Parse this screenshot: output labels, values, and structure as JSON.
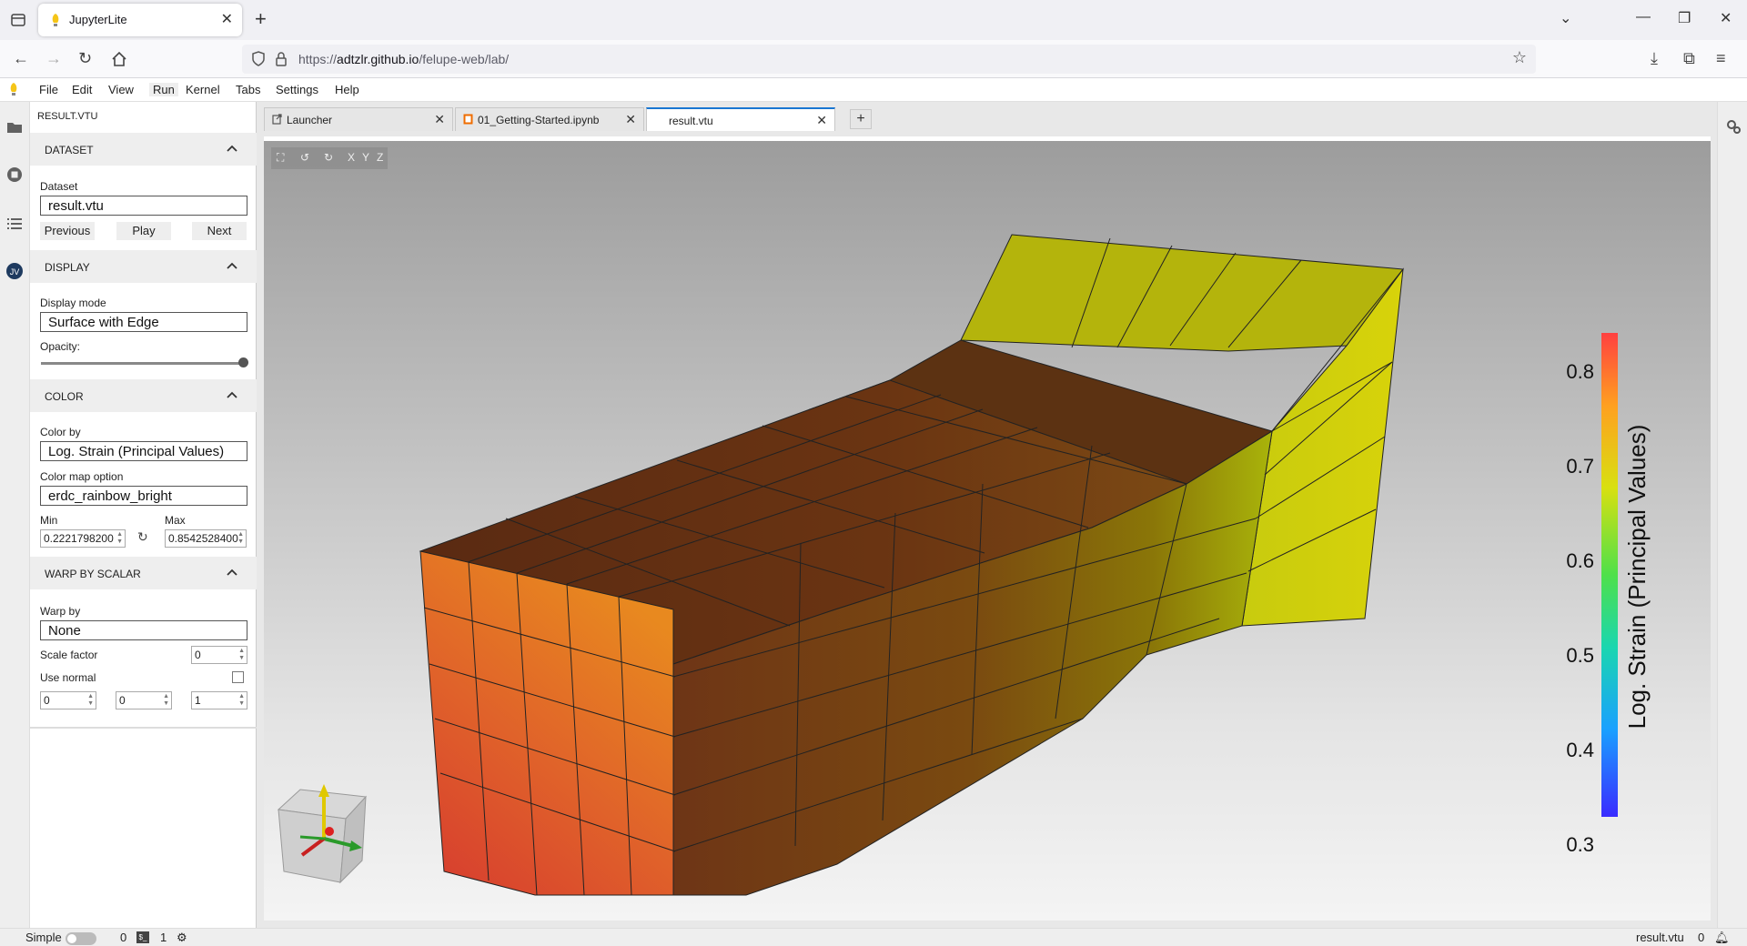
{
  "browser": {
    "tab_title": "JupyterLite",
    "url_host": "adtzlr.github.io",
    "url_prefix": "https://",
    "url_path": "/felupe-web/lab/"
  },
  "menubar": {
    "items": [
      "File",
      "Edit",
      "View",
      "Run",
      "Kernel",
      "Tabs",
      "Settings",
      "Help"
    ]
  },
  "panel": {
    "title": "RESULT.VTU",
    "dataset": {
      "header": "DATASET",
      "label": "Dataset",
      "value": "result.vtu",
      "previous": "Previous",
      "play": "Play",
      "next": "Next"
    },
    "display": {
      "header": "DISPLAY",
      "mode_label": "Display mode",
      "mode_value": "Surface with Edge",
      "opacity_label": "Opacity:",
      "opacity": 1.0
    },
    "color": {
      "header": "COLOR",
      "colorby_label": "Color by",
      "colorby_value": "Log. Strain (Principal Values)",
      "cmap_label": "Color map option",
      "cmap_value": "erdc_rainbow_bright",
      "min_label": "Min",
      "min_value": "0.2221798200",
      "max_label": "Max",
      "max_value": "0.8542528400"
    },
    "warp": {
      "header": "WARP BY SCALAR",
      "warpby_label": "Warp by",
      "warpby_value": "None",
      "scale_label": "Scale factor",
      "scale_value": "0",
      "normal_label": "Use normal",
      "use_normal": false,
      "nx": "0",
      "ny": "0",
      "nz": "1"
    }
  },
  "doc_tabs": [
    {
      "label": "Launcher",
      "icon": "launcher-icon"
    },
    {
      "label": "01_Getting-Started.ipynb",
      "icon": "notebook-icon"
    },
    {
      "label": "result.vtu",
      "icon": "",
      "active": true
    }
  ],
  "viewer": {
    "toolbar": [
      "reset-camera-icon",
      "rotate-left-icon",
      "rotate-right-icon",
      "X",
      "Y",
      "Z"
    ],
    "colorbar": {
      "title": "Log. Strain (Principal Values)",
      "ticks": [
        "0.8",
        "0.7",
        "0.6",
        "0.5",
        "0.4",
        "0.3"
      ],
      "min": 0.22218,
      "max": 0.85425
    }
  },
  "statusbar": {
    "mode": "Simple",
    "terminals": "0",
    "kernels": "1",
    "file": "result.vtu",
    "notifications": "0"
  }
}
